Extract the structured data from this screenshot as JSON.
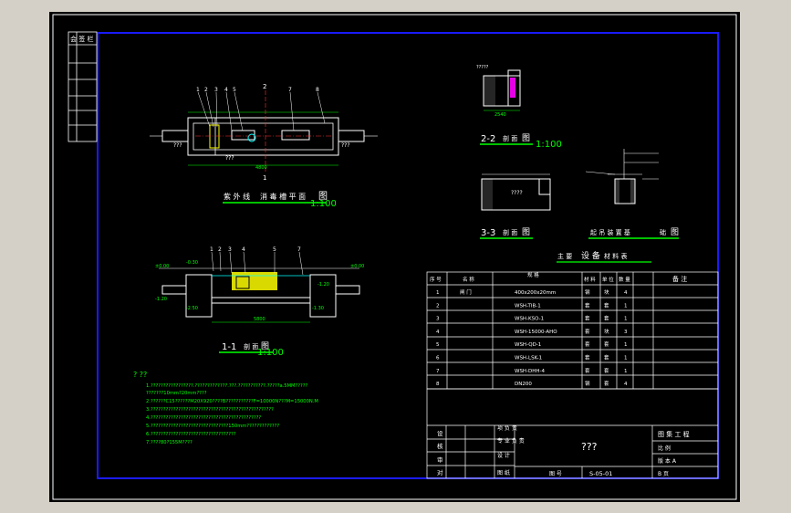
{
  "drawing": {
    "plan_title_a": "紫 外 线",
    "plan_title_b": "消 毒 槽 平 面",
    "plan_title_c": "图",
    "plan_scale": "1:100",
    "sec11_title_a": "1-1",
    "sec11_title_b": "剖 面",
    "sec11_title_c": "图",
    "sec11_scale": "1:100",
    "sec22_title_a": "2-2",
    "sec22_title_b": "剖 面",
    "sec22_title_c": "图",
    "sec22_scale": "1:100",
    "sec33_title_a": "3-3",
    "sec33_title_b": "剖 面",
    "sec33_title_c": "图",
    "hoist_title_a": "起 吊 装 置 基",
    "hoist_title_b": "础",
    "hoist_title_c": "图",
    "cut_mark_2": "2",
    "cut_mark_1": "1",
    "dim_total_plan": "4800",
    "dim_total_sec": "5800",
    "sec22_label": "?????",
    "sec22_dim": "2540",
    "sec33_label": "????",
    "elev_1": "±0.00",
    "elev_2": "-0.30",
    "elev_3": "-1.20",
    "elev_4": "-2.50",
    "elev_5": "-1.30",
    "elev_6": "-1.20",
    "elev_7": "±0.00",
    "plan_label_left": "???",
    "plan_label_right": "???",
    "plan_label_bottom": "???"
  },
  "notes": {
    "heading": "? ??",
    "lines": [
      "1.?????????????????.?????????????.???.???????????.?????a.5MM?????",
      "  ???????10mm?20mm????",
      "2.??????C15??????M20X920????B???????????F=10000N???M=15000N.M",
      "3.?????????????????????????????????????????????????",
      "4.????????????????????????????????????????????",
      "5.???????????????????????????????150mm?????????????",
      "6.??????????????????????????????????",
      "7.????80?155M????"
    ]
  },
  "table": {
    "title_a": "主 要",
    "title_b": "设 备",
    "title_c": "材 料 表",
    "headers": [
      "序 号",
      "名 称",
      "规 格",
      "材 料",
      "单 位",
      "数 量",
      "备 注"
    ],
    "rows": [
      [
        "1",
        "闸 门",
        "400x200x20mm",
        "钢",
        "块",
        "4",
        ""
      ],
      [
        "2",
        "",
        "WSH-TIB-1",
        "套",
        "套",
        "1",
        ""
      ],
      [
        "3",
        "",
        "WSH-KSO-1",
        "套",
        "套",
        "1",
        ""
      ],
      [
        "4",
        "",
        "WSH-15000-AHO",
        "套",
        "块",
        "3",
        ""
      ],
      [
        "5",
        "",
        "WSH-QD-1",
        "套",
        "套",
        "1",
        ""
      ],
      [
        "6",
        "",
        "WSH-LSK-1",
        "套",
        "套",
        "1",
        ""
      ],
      [
        "7",
        "",
        "WSH-DHH-4",
        "套",
        "套",
        "1",
        ""
      ],
      [
        "8",
        "",
        "DN200",
        "钢",
        "套",
        "4",
        ""
      ]
    ]
  },
  "title_block": {
    "center_text": "???",
    "project": "图 集 工 程",
    "cell_a": "比 例",
    "cell_b": "版 本 A",
    "drawing_no_label": "图 号",
    "drawing_no": "S-05-01",
    "page_label": "B 页",
    "left_labels": [
      "设",
      "核",
      "审",
      "对"
    ],
    "sig_labels": [
      "项 负 责",
      "专 业 负 责",
      "设 计",
      "图 纸"
    ]
  },
  "side_strip": {
    "header": "会 签 栏"
  },
  "colors": {
    "background": "#000000",
    "border": "#ffffff",
    "inner_frame": "#1a1aff",
    "lines": "#ffffff",
    "annotation": "#00ff00",
    "cyan": "#00ffff",
    "yellow": "#ffff00",
    "magenta": "#ff00ff",
    "red": "#ff3030"
  }
}
